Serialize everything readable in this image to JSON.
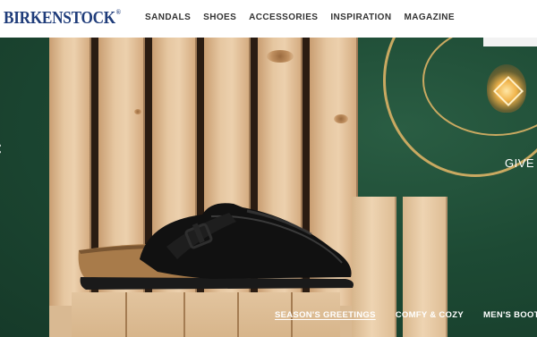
{
  "brand": {
    "logo_text": "BIRKENSTOCK",
    "logo_mark": "®",
    "color": "#1f3c7a"
  },
  "nav": {
    "items": [
      {
        "label": "SANDALS"
      },
      {
        "label": "SHOES"
      },
      {
        "label": "ACCESSORIES"
      },
      {
        "label": "INSPIRATION"
      },
      {
        "label": "MAGAZINE"
      }
    ]
  },
  "hero": {
    "prev_icon": "chevron-left-icon",
    "prev_glyph": "‹",
    "side_text": "GIVE",
    "promos": [
      {
        "label": "SEASON'S GREETINGS",
        "active": true
      },
      {
        "label": "COMFY & COZY",
        "active": false
      },
      {
        "label": "MEN'S BOOTS",
        "active": false
      }
    ],
    "colors": {
      "wall_green": "#1d4a34",
      "ring_gold": "#c9a961"
    }
  }
}
